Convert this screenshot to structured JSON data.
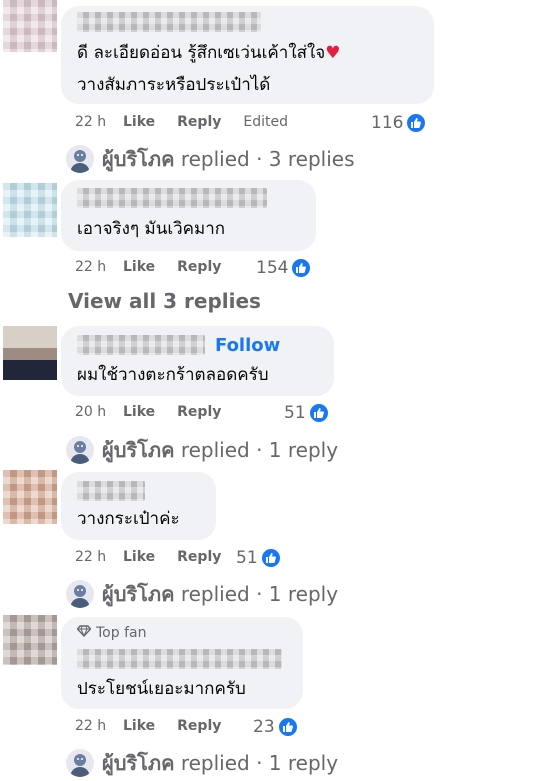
{
  "comments": [
    {
      "text_lines": [
        "ดี ละเอียดอ่อน รู้สึกเซเว่นเค้าใส่ใจ",
        "วางสัมภาระหรือประเป๋าได้"
      ],
      "heart": "♥",
      "time": "22 h",
      "like": "Like",
      "reply": "Reply",
      "edited": "Edited",
      "reactions": "116",
      "replied": {
        "name": "ผู้บริโภค",
        "text": "replied · 3 replies"
      }
    },
    {
      "text_lines": [
        "เอาจริงๆ มันเวิคมาก"
      ],
      "time": "22 h",
      "like": "Like",
      "reply": "Reply",
      "reactions": "154",
      "view_all": "View all 3 replies"
    },
    {
      "follow": "Follow",
      "text_lines": [
        "ผมใช้วางตะกร้าตลอดครับ"
      ],
      "time": "20 h",
      "like": "Like",
      "reply": "Reply",
      "reactions": "51",
      "replied": {
        "name": "ผู้บริโภค",
        "text": "replied · 1 reply"
      }
    },
    {
      "text_lines": [
        "วางกระเป๋าค่ะ"
      ],
      "time": "22 h",
      "like": "Like",
      "reply": "Reply",
      "reactions": "51",
      "replied": {
        "name": "ผู้บริโภค",
        "text": "replied · 1 reply"
      }
    },
    {
      "badge": "Top fan",
      "text_lines": [
        "ประโยชน์เยอะมากครับ"
      ],
      "time": "22 h",
      "like": "Like",
      "reply": "Reply",
      "reactions": "23",
      "replied": {
        "name": "ผู้บริโภค",
        "text": "replied · 1 reply"
      }
    }
  ],
  "colors": {
    "accent": "#1877f2",
    "bubble": "#f0f2f5",
    "meta": "#65676b",
    "heart": "#e41e3f"
  },
  "icons": {
    "like": "thumbs-up-icon",
    "badge": "diamond-icon",
    "reply_avatar": "profile-avatar"
  }
}
